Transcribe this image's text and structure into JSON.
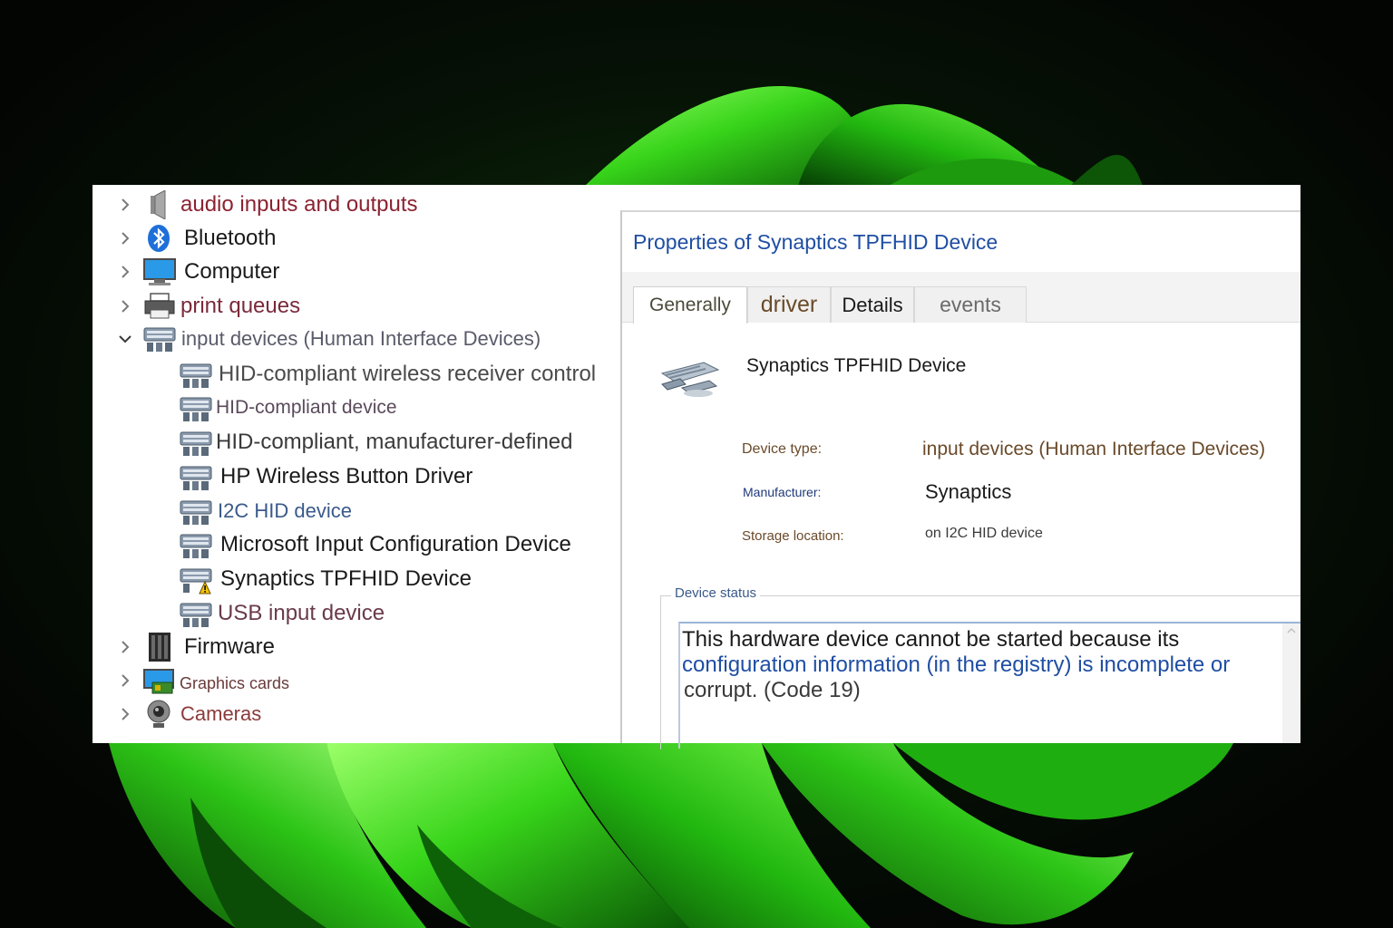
{
  "device_manager": {
    "categories_top": [
      {
        "id": "audio",
        "label": "audio inputs and outputs",
        "color": "#8b2332",
        "icon": "speaker-icon"
      },
      {
        "id": "bluetooth",
        "label": "Bluetooth",
        "color": "#1a1a1a",
        "icon": "bluetooth-icon"
      },
      {
        "id": "computer",
        "label": "Computer",
        "color": "#1a1a1a",
        "icon": "monitor-icon"
      },
      {
        "id": "print-queues",
        "label": "print queues",
        "color": "#7a2a3a",
        "icon": "printer-icon"
      },
      {
        "id": "input-devices",
        "label": "input devices (Human Interface Devices)",
        "color": "#5a5a6a",
        "icon": "hid-icon",
        "expanded": true
      }
    ],
    "children": [
      {
        "label": "HID-compliant wireless receiver control",
        "color": "#4a4a4a",
        "icon": "hid-icon"
      },
      {
        "label": "HID-compliant device",
        "color": "#5a4a5a",
        "icon": "hid-icon"
      },
      {
        "label": "HID-compliant, manufacturer-defined",
        "color": "#3a3a3a",
        "icon": "hid-icon"
      },
      {
        "label": "HP Wireless Button Driver",
        "color": "#1a1a1a",
        "icon": "hid-icon"
      },
      {
        "label": "I2C HID device",
        "color": "#3a5a8a",
        "icon": "hid-icon"
      },
      {
        "label": "Microsoft Input Configuration Device",
        "color": "#1a1a1a",
        "icon": "hid-icon"
      },
      {
        "label": "Synaptics TPFHID Device",
        "color": "#1a1a1a",
        "icon": "hid-warning-icon"
      },
      {
        "label": "USB input device",
        "color": "#6a3a4a",
        "icon": "hid-icon"
      }
    ],
    "categories_bottom": [
      {
        "id": "firmware",
        "label": "Firmware",
        "color": "#1a1a1a",
        "icon": "chip-icon"
      },
      {
        "id": "graphics-cards",
        "label": "Graphics cards",
        "color": "#6a3a3a",
        "icon": "display-adapter-icon"
      },
      {
        "id": "cameras",
        "label": "Cameras",
        "color": "#8b3a3a",
        "icon": "webcam-icon"
      }
    ]
  },
  "properties": {
    "title": "Properties of Synaptics TPFHID Device",
    "tabs": [
      {
        "label": "Generally",
        "color": "#4a4a3a",
        "active": true
      },
      {
        "label": "driver",
        "color": "#6a4a2a"
      },
      {
        "label": "Details",
        "color": "#1a1a1a"
      },
      {
        "label": "events",
        "color": "#6a6a6a"
      }
    ],
    "device_name": "Synaptics TPFHID Device",
    "device_type_label": "Device type:",
    "device_type_value": "input devices (Human Interface Devices)",
    "manufacturer_label": "Manufacturer:",
    "manufacturer_value": "Synaptics",
    "location_label": "Storage location:",
    "location_value": "on I2C HID device",
    "status_legend": "Device status",
    "status_lines": [
      "This hardware device cannot be started because its",
      "configuration information (in the registry) is incomplete or",
      "corrupt. (Code 19)"
    ]
  },
  "colors": {
    "title_blue": "#1f4ea3",
    "wallpaper_green": "#2fd11a",
    "wallpaper_dark": "#050805"
  }
}
